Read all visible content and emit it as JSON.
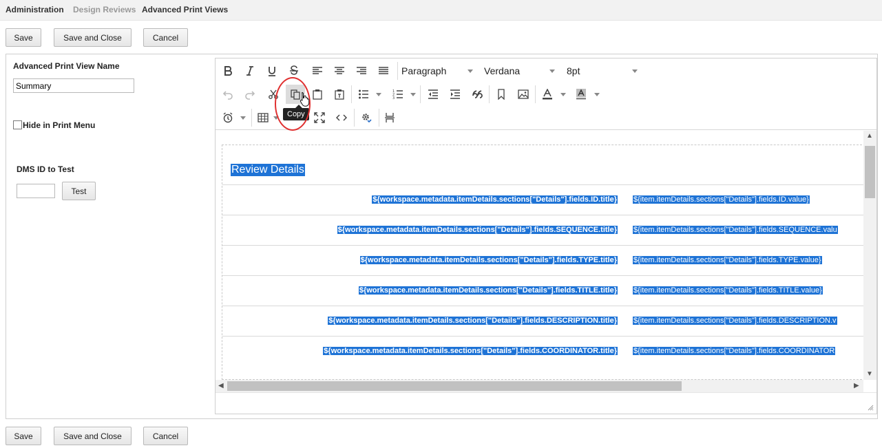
{
  "breadcrumb": {
    "administration": "Administration",
    "design_reviews": "Design Reviews",
    "advanced_print_views": "Advanced Print Views"
  },
  "actions": {
    "save": "Save",
    "save_and_close": "Save and Close",
    "cancel": "Cancel"
  },
  "form": {
    "name_label": "Advanced Print View Name",
    "name_value": "Summary",
    "hide_label": "Hide in Print Menu",
    "dms_label": "DMS ID to Test",
    "dms_value": "",
    "test_button": "Test"
  },
  "toolbar": {
    "format": "Paragraph",
    "font": "Verdana",
    "size": "8pt",
    "tooltip": "Copy",
    "icons": [
      "bold-icon",
      "italic-icon",
      "underline-icon",
      "strikethrough-icon",
      "align-left-icon",
      "align-center-icon",
      "align-right-icon",
      "align-justify-icon",
      "undo-icon",
      "redo-icon",
      "cut-icon",
      "copy-icon",
      "paste-icon",
      "paste-text-icon",
      "bullet-list-icon",
      "numbered-list-icon",
      "outdent-icon",
      "indent-icon",
      "blockquote-icon",
      "bookmark-icon",
      "image-icon",
      "text-color-icon",
      "background-color-icon",
      "alarm-clock-icon",
      "table-icon",
      "fullscreen-icon",
      "code-icon",
      "settings-icon",
      "page-break-icon"
    ]
  },
  "content": {
    "heading": "Review Details",
    "rows": [
      {
        "title": "${workspace.metadata.itemDetails.sections[\"Details\"].fields.ID.title}",
        "value": "${item.itemDetails.sections[\"Details\"].fields.ID.value}"
      },
      {
        "title": "${workspace.metadata.itemDetails.sections[\"Details\"].fields.SEQUENCE.title}",
        "value": "${item.itemDetails.sections[\"Details\"].fields.SEQUENCE.valu"
      },
      {
        "title": "${workspace.metadata.itemDetails.sections[\"Details\"].fields.TYPE.title}",
        "value": "${item.itemDetails.sections[\"Details\"].fields.TYPE.value}"
      },
      {
        "title": "${workspace.metadata.itemDetails.sections[\"Details\"].fields.TITLE.title}",
        "value": "${item.itemDetails.sections[\"Details\"].fields.TITLE.value}"
      },
      {
        "title": "${workspace.metadata.itemDetails.sections[\"Details\"].fields.DESCRIPTION.title}",
        "value": "${item.itemDetails.sections[\"Details\"].fields.DESCRIPTION.v"
      },
      {
        "title": "${workspace.metadata.itemDetails.sections[\"Details\"].fields.COORDINATOR.title}",
        "value": "${item.itemDetails.sections[\"Details\"].fields.COORDINATOR"
      }
    ]
  },
  "colors": {
    "selection": "#1e73d6",
    "highlight_ring": "#e03030"
  }
}
